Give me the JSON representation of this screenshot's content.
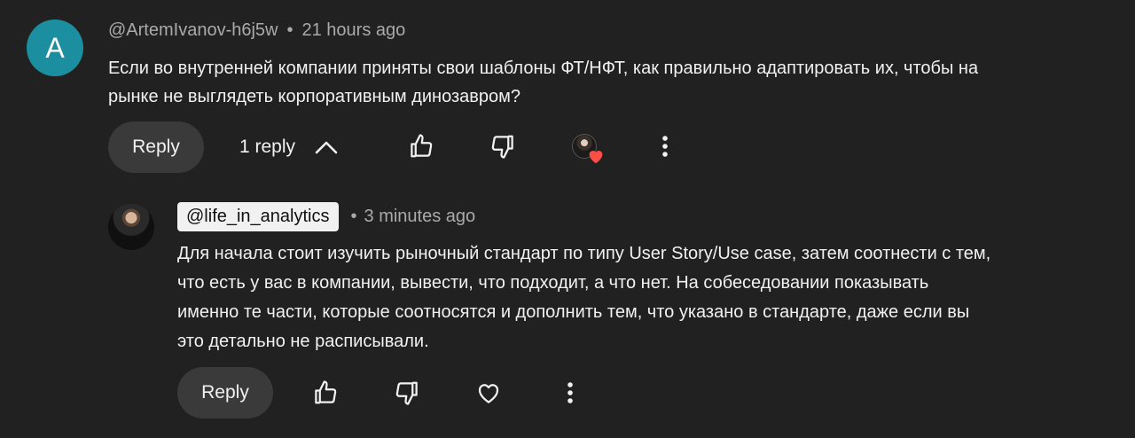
{
  "comment": {
    "avatar_letter": "A",
    "author": "@ArtemIvanov-h6j5w",
    "separator": "•",
    "time": "21 hours ago",
    "text": "Если во внутренней компании приняты свои шаблоны ФТ/НФТ, как правильно адаптировать их, чтобы на рынке не выглядеть корпоративным динозавром?",
    "reply_label": "Reply",
    "replies_count_label": "1 reply",
    "icons": {
      "like": "thumbs-up-icon",
      "dislike": "thumbs-down-icon",
      "creator_heart": "creator-heart-icon",
      "more": "more-vert-icon"
    }
  },
  "reply": {
    "author": "@life_in_analytics",
    "separator": "•",
    "time": "3 minutes ago",
    "text": "Для начала стоит изучить рыночный стандарт по типу User Story/Use case, затем соотнести с тем, что есть у вас в компании, вывести, что подходит, а что нет. На собеседовании показывать именно те части, которые соотносятся и дополнить тем, что указано в стандарте, даже если вы это детально не расписывали.",
    "reply_label": "Reply",
    "icons": {
      "like": "thumbs-up-icon",
      "dislike": "thumbs-down-icon",
      "heart": "heart-icon",
      "more": "more-vert-icon"
    }
  },
  "colors": {
    "background": "#212121",
    "avatar_bg": "#1b8fa0",
    "heart_red": "#ff4e45",
    "button_bg": "#3a3a3a"
  }
}
